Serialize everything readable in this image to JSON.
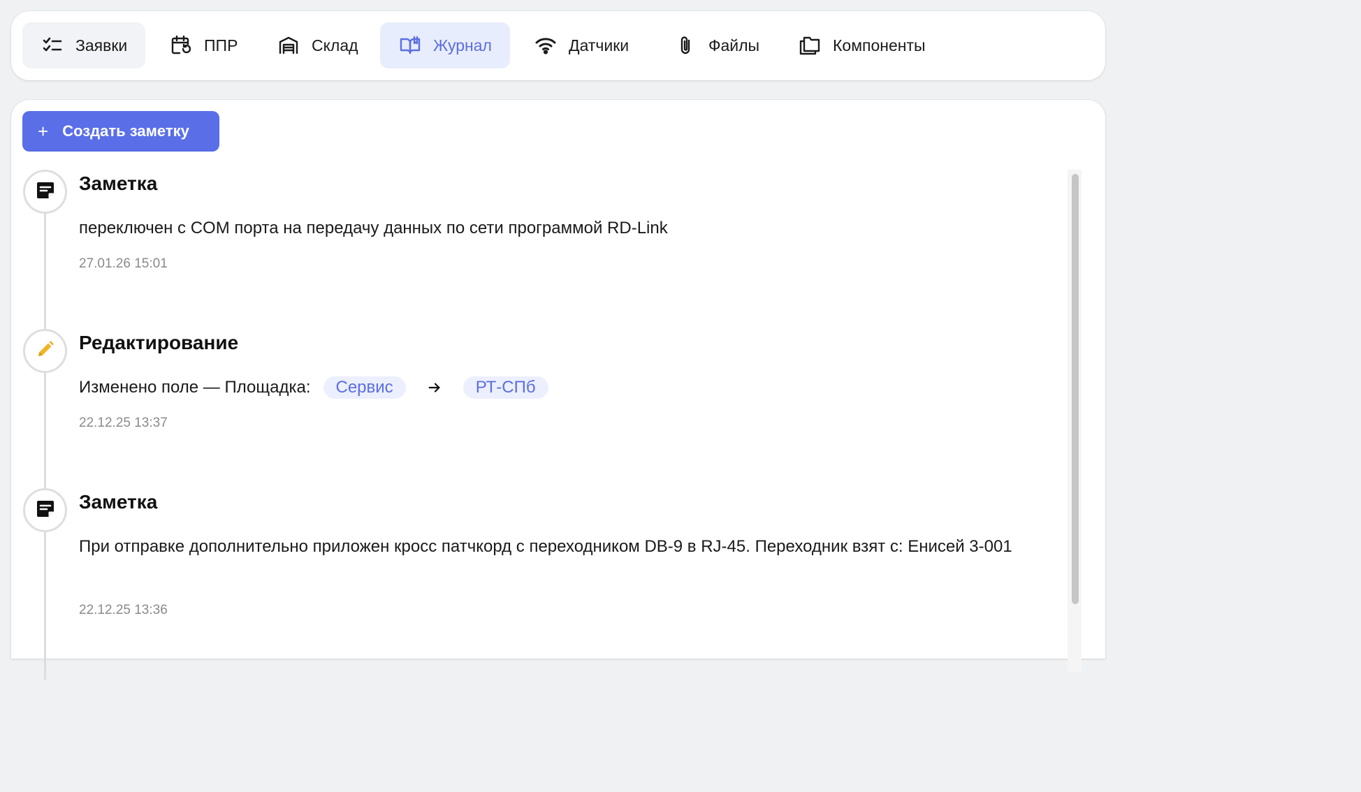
{
  "tabs": [
    {
      "label": "Заявки",
      "icon": "checklist-icon"
    },
    {
      "label": "ППР",
      "icon": "calendar-refresh-icon"
    },
    {
      "label": "Склад",
      "icon": "warehouse-icon"
    },
    {
      "label": "Журнал",
      "icon": "open-book-icon",
      "active": true
    },
    {
      "label": "Датчики",
      "icon": "wifi-icon"
    },
    {
      "label": "Файлы",
      "icon": "paperclip-icon"
    },
    {
      "label": "Компоненты",
      "icon": "folders-icon"
    }
  ],
  "create_button": {
    "plus": "+",
    "label": "Создать заметку"
  },
  "entries": [
    {
      "type": "note",
      "icon": "note-icon",
      "title": "Заметка",
      "text": "переключен с COM порта на передачу данных по сети программой RD-Link",
      "time": "27.01.26 15:01"
    },
    {
      "type": "edit",
      "icon": "pencil-icon",
      "title": "Редактирование",
      "change_label": "Изменено поле — Площадка:",
      "old_value": "Сервис",
      "new_value": "РТ-СПб",
      "time": "22.12.25 13:37"
    },
    {
      "type": "note",
      "icon": "note-icon",
      "title": "Заметка",
      "text": "При отправке дополнительно приложен кросс патчкорд с переходником DB-9 в RJ-45. Переходник взят с: Енисей 3-001",
      "time": "22.12.25 13:36"
    }
  ],
  "colors": {
    "accent": "#5a6ee8",
    "active_tab_bg": "#e8edfd",
    "active_tab_text": "#5b6fe0",
    "pencil": "#f0b429",
    "timestamp": "#8a8a8a"
  }
}
